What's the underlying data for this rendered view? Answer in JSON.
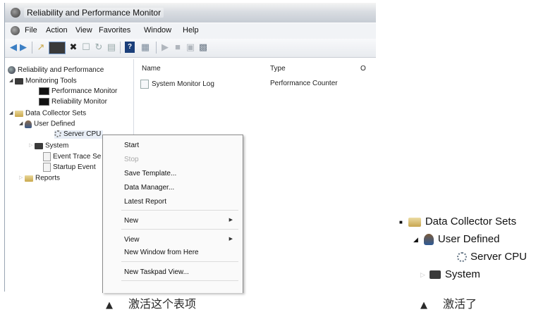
{
  "window": {
    "title": "Reliability and Performance Monitor",
    "menus": [
      "File",
      "Action",
      "View",
      "Favorites",
      "Window",
      "Help"
    ]
  },
  "toolbar": {
    "icons": [
      "back-arrow-icon",
      "forward-arrow-icon",
      "up-folder-icon",
      "show-hide-tree-icon",
      "delete-icon",
      "properties-icon",
      "refresh-icon",
      "export-icon",
      "help-icon",
      "console-icon",
      "start-icon",
      "stop-icon",
      "new-icon",
      "report-icon"
    ]
  },
  "tree": {
    "root": "Reliability and Performance",
    "monitoring_tools": "Monitoring Tools",
    "performance_monitor": "Performance Monitor",
    "reliability_monitor": "Reliability Monitor",
    "data_collector_sets": "Data Collector Sets",
    "user_defined": "User Defined",
    "server_cpu": "Server CPU",
    "system": "System",
    "event_trace": "Event Trace Se",
    "startup_event": "Startup Event",
    "reports": "Reports"
  },
  "list": {
    "columns": [
      "Name",
      "Type",
      "O"
    ],
    "row": {
      "name": "System Monitor Log",
      "type": "Performance Counter"
    }
  },
  "context_menu": {
    "start": "Start",
    "stop": "Stop",
    "save_template": "Save Template...",
    "data_manager": "Data Manager...",
    "latest_report": "Latest Report",
    "new": "New",
    "view": "View",
    "new_window": "New Window from Here",
    "new_taskpad": "New Taskpad View..."
  },
  "zoom": {
    "data_collector_sets": "Data Collector Sets",
    "user_defined": "User Defined",
    "server_cpu": "Server CPU",
    "system": "System"
  },
  "captions": {
    "left_marker": "▲",
    "left": "激活这个表项",
    "right_marker": "▲",
    "right": "激活了"
  },
  "colors": {
    "accent_gold": "#e9c46a",
    "selection": "#cfe3f7"
  }
}
